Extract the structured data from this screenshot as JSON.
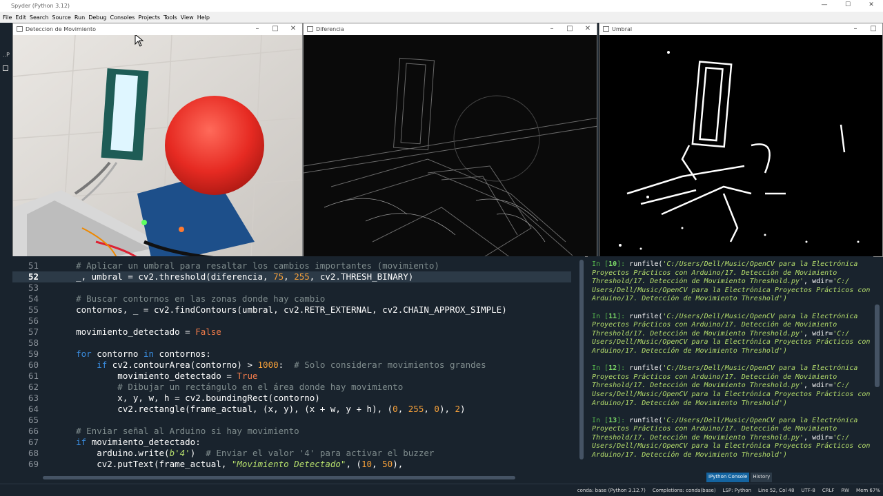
{
  "app": {
    "title": "Spyder (Python 3.12)"
  },
  "menu": [
    "File",
    "Edit",
    "Search",
    "Source",
    "Run",
    "Debug",
    "Consoles",
    "Projects",
    "Tools",
    "View",
    "Help"
  ],
  "windows": {
    "deteccion": {
      "title": "Deteccion de Movimiento"
    },
    "diferencia": {
      "title": "Diferencia"
    },
    "umbral": {
      "title": "Umbral"
    }
  },
  "editor": {
    "current_line": 52,
    "lines": [
      {
        "n": "51",
        "html": "<span class=\"cm\">    # Aplicar un umbral para resaltar los cambios importantes (movimiento)</span>"
      },
      {
        "n": "52",
        "html": "    _, umbral = cv2.threshold(diferencia, <span class=\"nm\">75</span>, <span class=\"nm\">255</span>, cv2.THRESH_BINARY)",
        "current": true
      },
      {
        "n": "53",
        "html": ""
      },
      {
        "n": "54",
        "html": "<span class=\"cm\">    # Buscar contornos en las zonas donde hay cambio</span>"
      },
      {
        "n": "55",
        "html": "    contornos, _ = cv2.findContours(umbral, cv2.RETR_EXTERNAL, cv2.CHAIN_APPROX_SIMPLE)"
      },
      {
        "n": "56",
        "html": ""
      },
      {
        "n": "57",
        "html": "    movimiento_detectado = <span class=\"bo\">False</span>"
      },
      {
        "n": "58",
        "html": ""
      },
      {
        "n": "59",
        "html": "    <span class=\"kw\">for</span> contorno <span class=\"kw\">in</span> contornos:"
      },
      {
        "n": "60",
        "html": "        <span class=\"kw\">if</span> cv2.contourArea(contorno) &gt; <span class=\"nm\">1000</span>:  <span class=\"cm\"># Solo considerar movimientos grandes</span>"
      },
      {
        "n": "61",
        "html": "            movimiento_detectado = <span class=\"bo\">True</span>"
      },
      {
        "n": "62",
        "html": "<span class=\"cm\">            # Dibujar un rectángulo en el área donde hay movimiento</span>"
      },
      {
        "n": "63",
        "html": "            x, y, w, h = cv2.boundingRect(contorno)"
      },
      {
        "n": "64",
        "html": "            cv2.rectangle(frame_actual, (x, y), (x + w, y + h), (<span class=\"nm\">0</span>, <span class=\"nm\">255</span>, <span class=\"nm\">0</span>), <span class=\"nm\">2</span>)"
      },
      {
        "n": "65",
        "html": ""
      },
      {
        "n": "66",
        "html": "<span class=\"cm\">    # Enviar señal al Arduino si hay movimiento</span>"
      },
      {
        "n": "67",
        "html": "    <span class=\"kw\">if</span> movimiento_detectado:"
      },
      {
        "n": "68",
        "html": "        arduino.write(<span class=\"st\">b'4'</span>)  <span class=\"cm\"># Enviar el valor '4' para activar el buzzer</span>"
      },
      {
        "n": "69",
        "html": "        cv2.putText(frame_actual, <span class=\"st\">\"Movimiento Detectado\"</span>, (<span class=\"nm\">10</span>, <span class=\"nm\">50</span>),"
      }
    ]
  },
  "console": {
    "blocks": [
      {
        "num": "10",
        "lines": [
          "'C:/Users/Dell/Music/OpenCV para la Electrónica",
          "Proyectos Prácticos con Arduino/17. Detección de Movimiento",
          "Threshold/17. Detección de Movimiento Threshold.py'",
          "Users/Dell/Music/OpenCV para la Electrónica Proyectos Prácticos con",
          "Arduino/17. Detección de Movimiento Threshold')"
        ],
        "wdir": "'C:/"
      },
      {
        "num": "11",
        "lines": [
          "'C:/Users/Dell/Music/OpenCV para la Electrónica",
          "Proyectos Prácticos con Arduino/17. Detección de Movimiento",
          "Threshold/17. Detección de Movimiento Threshold.py'",
          "Users/Dell/Music/OpenCV para la Electrónica Proyectos Prácticos con",
          "Arduino/17. Detección de Movimiento Threshold')"
        ],
        "wdir": "'C:/"
      },
      {
        "num": "12",
        "lines": [
          "'C:/Users/Dell/Music/OpenCV para la Electrónica",
          "Proyectos Prácticos con Arduino/17. Detección de Movimiento",
          "Threshold/17. Detección de Movimiento Threshold.py'",
          "Users/Dell/Music/OpenCV para la Electrónica Proyectos Prácticos con",
          "Arduino/17. Detección de Movimiento Threshold')"
        ],
        "wdir": "'C:/"
      },
      {
        "num": "13",
        "lines": [
          "'C:/Users/Dell/Music/OpenCV para la Electrónica",
          "Proyectos Prácticos con Arduino/17. Detección de Movimiento",
          "Threshold/17. Detección de Movimiento Threshold.py'",
          "Users/Dell/Music/OpenCV para la Electrónica Proyectos Prácticos con",
          "Arduino/17. Detección de Movimiento Threshold')"
        ],
        "wdir": "'C:/"
      }
    ],
    "tabs": [
      "IPython Console",
      "History"
    ]
  },
  "status": {
    "env": "conda: base (Python 3.12.7)",
    "completions": "Completions: conda(base)",
    "lsp": "LSP: Python",
    "position": "Line 52, Col 48",
    "encoding": "UTF-8",
    "eol": "CRLF",
    "perm": "RW",
    "mem": "Mem 67%"
  }
}
